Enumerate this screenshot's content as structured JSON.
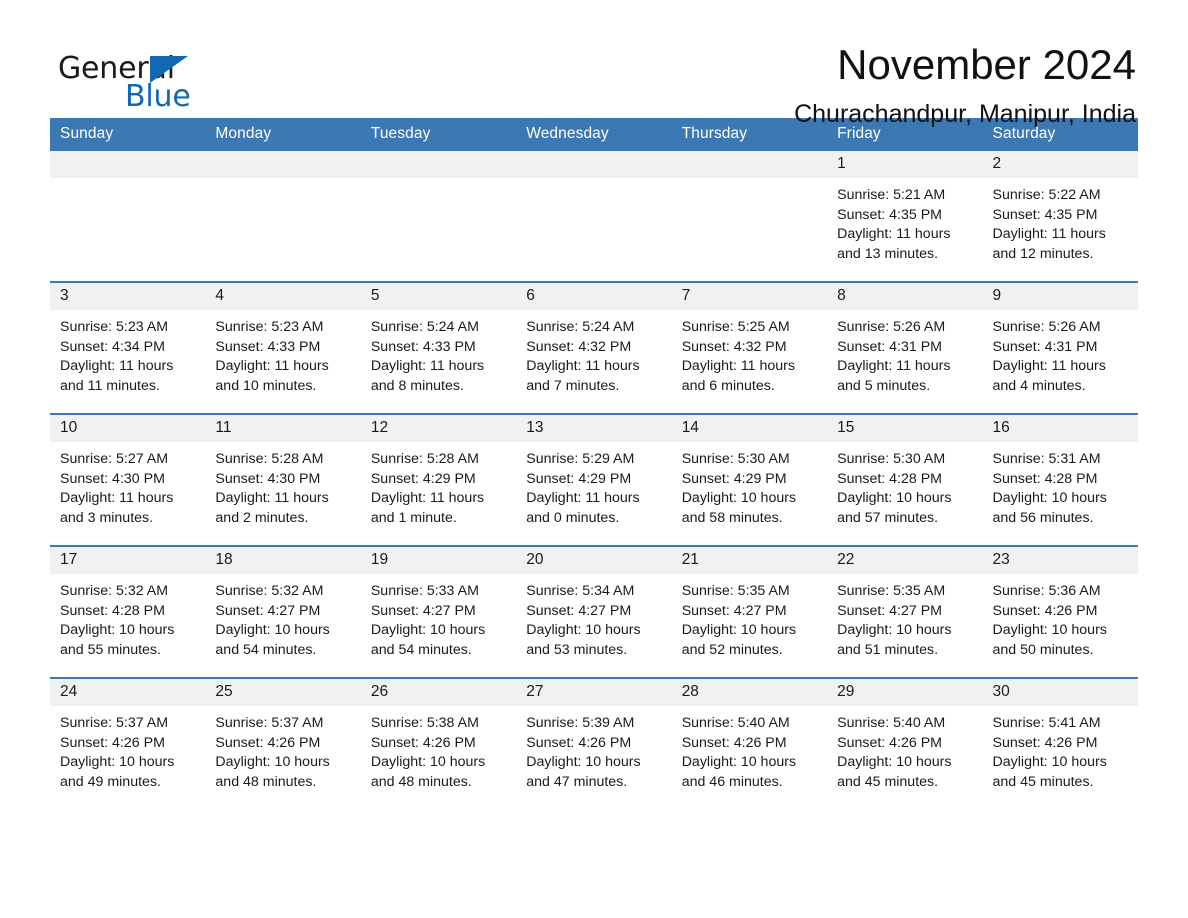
{
  "brand": {
    "name_part1": "General",
    "name_part2": "Blue",
    "accent_color": "#1268b3",
    "triangle_icon": "triangle-icon"
  },
  "header": {
    "month_title": "November 2024",
    "location": "Churachandpur, Manipur, India"
  },
  "colors": {
    "header_blue": "#3b78b4",
    "day_band_gray": "#f1f1f1",
    "text": "#1a1a1a"
  },
  "calendar": {
    "weekday_headers": [
      "Sunday",
      "Monday",
      "Tuesday",
      "Wednesday",
      "Thursday",
      "Friday",
      "Saturday"
    ],
    "weeks": [
      [
        {
          "day": "",
          "lines": []
        },
        {
          "day": "",
          "lines": []
        },
        {
          "day": "",
          "lines": []
        },
        {
          "day": "",
          "lines": []
        },
        {
          "day": "",
          "lines": []
        },
        {
          "day": "1",
          "lines": [
            "Sunrise: 5:21 AM",
            "Sunset: 4:35 PM",
            "Daylight: 11 hours and 13 minutes."
          ]
        },
        {
          "day": "2",
          "lines": [
            "Sunrise: 5:22 AM",
            "Sunset: 4:35 PM",
            "Daylight: 11 hours and 12 minutes."
          ]
        }
      ],
      [
        {
          "day": "3",
          "lines": [
            "Sunrise: 5:23 AM",
            "Sunset: 4:34 PM",
            "Daylight: 11 hours and 11 minutes."
          ]
        },
        {
          "day": "4",
          "lines": [
            "Sunrise: 5:23 AM",
            "Sunset: 4:33 PM",
            "Daylight: 11 hours and 10 minutes."
          ]
        },
        {
          "day": "5",
          "lines": [
            "Sunrise: 5:24 AM",
            "Sunset: 4:33 PM",
            "Daylight: 11 hours and 8 minutes."
          ]
        },
        {
          "day": "6",
          "lines": [
            "Sunrise: 5:24 AM",
            "Sunset: 4:32 PM",
            "Daylight: 11 hours and 7 minutes."
          ]
        },
        {
          "day": "7",
          "lines": [
            "Sunrise: 5:25 AM",
            "Sunset: 4:32 PM",
            "Daylight: 11 hours and 6 minutes."
          ]
        },
        {
          "day": "8",
          "lines": [
            "Sunrise: 5:26 AM",
            "Sunset: 4:31 PM",
            "Daylight: 11 hours and 5 minutes."
          ]
        },
        {
          "day": "9",
          "lines": [
            "Sunrise: 5:26 AM",
            "Sunset: 4:31 PM",
            "Daylight: 11 hours and 4 minutes."
          ]
        }
      ],
      [
        {
          "day": "10",
          "lines": [
            "Sunrise: 5:27 AM",
            "Sunset: 4:30 PM",
            "Daylight: 11 hours and 3 minutes."
          ]
        },
        {
          "day": "11",
          "lines": [
            "Sunrise: 5:28 AM",
            "Sunset: 4:30 PM",
            "Daylight: 11 hours and 2 minutes."
          ]
        },
        {
          "day": "12",
          "lines": [
            "Sunrise: 5:28 AM",
            "Sunset: 4:29 PM",
            "Daylight: 11 hours and 1 minute."
          ]
        },
        {
          "day": "13",
          "lines": [
            "Sunrise: 5:29 AM",
            "Sunset: 4:29 PM",
            "Daylight: 11 hours and 0 minutes."
          ]
        },
        {
          "day": "14",
          "lines": [
            "Sunrise: 5:30 AM",
            "Sunset: 4:29 PM",
            "Daylight: 10 hours and 58 minutes."
          ]
        },
        {
          "day": "15",
          "lines": [
            "Sunrise: 5:30 AM",
            "Sunset: 4:28 PM",
            "Daylight: 10 hours and 57 minutes."
          ]
        },
        {
          "day": "16",
          "lines": [
            "Sunrise: 5:31 AM",
            "Sunset: 4:28 PM",
            "Daylight: 10 hours and 56 minutes."
          ]
        }
      ],
      [
        {
          "day": "17",
          "lines": [
            "Sunrise: 5:32 AM",
            "Sunset: 4:28 PM",
            "Daylight: 10 hours and 55 minutes."
          ]
        },
        {
          "day": "18",
          "lines": [
            "Sunrise: 5:32 AM",
            "Sunset: 4:27 PM",
            "Daylight: 10 hours and 54 minutes."
          ]
        },
        {
          "day": "19",
          "lines": [
            "Sunrise: 5:33 AM",
            "Sunset: 4:27 PM",
            "Daylight: 10 hours and 54 minutes."
          ]
        },
        {
          "day": "20",
          "lines": [
            "Sunrise: 5:34 AM",
            "Sunset: 4:27 PM",
            "Daylight: 10 hours and 53 minutes."
          ]
        },
        {
          "day": "21",
          "lines": [
            "Sunrise: 5:35 AM",
            "Sunset: 4:27 PM",
            "Daylight: 10 hours and 52 minutes."
          ]
        },
        {
          "day": "22",
          "lines": [
            "Sunrise: 5:35 AM",
            "Sunset: 4:27 PM",
            "Daylight: 10 hours and 51 minutes."
          ]
        },
        {
          "day": "23",
          "lines": [
            "Sunrise: 5:36 AM",
            "Sunset: 4:26 PM",
            "Daylight: 10 hours and 50 minutes."
          ]
        }
      ],
      [
        {
          "day": "24",
          "lines": [
            "Sunrise: 5:37 AM",
            "Sunset: 4:26 PM",
            "Daylight: 10 hours and 49 minutes."
          ]
        },
        {
          "day": "25",
          "lines": [
            "Sunrise: 5:37 AM",
            "Sunset: 4:26 PM",
            "Daylight: 10 hours and 48 minutes."
          ]
        },
        {
          "day": "26",
          "lines": [
            "Sunrise: 5:38 AM",
            "Sunset: 4:26 PM",
            "Daylight: 10 hours and 48 minutes."
          ]
        },
        {
          "day": "27",
          "lines": [
            "Sunrise: 5:39 AM",
            "Sunset: 4:26 PM",
            "Daylight: 10 hours and 47 minutes."
          ]
        },
        {
          "day": "28",
          "lines": [
            "Sunrise: 5:40 AM",
            "Sunset: 4:26 PM",
            "Daylight: 10 hours and 46 minutes."
          ]
        },
        {
          "day": "29",
          "lines": [
            "Sunrise: 5:40 AM",
            "Sunset: 4:26 PM",
            "Daylight: 10 hours and 45 minutes."
          ]
        },
        {
          "day": "30",
          "lines": [
            "Sunrise: 5:41 AM",
            "Sunset: 4:26 PM",
            "Daylight: 10 hours and 45 minutes."
          ]
        }
      ]
    ]
  }
}
